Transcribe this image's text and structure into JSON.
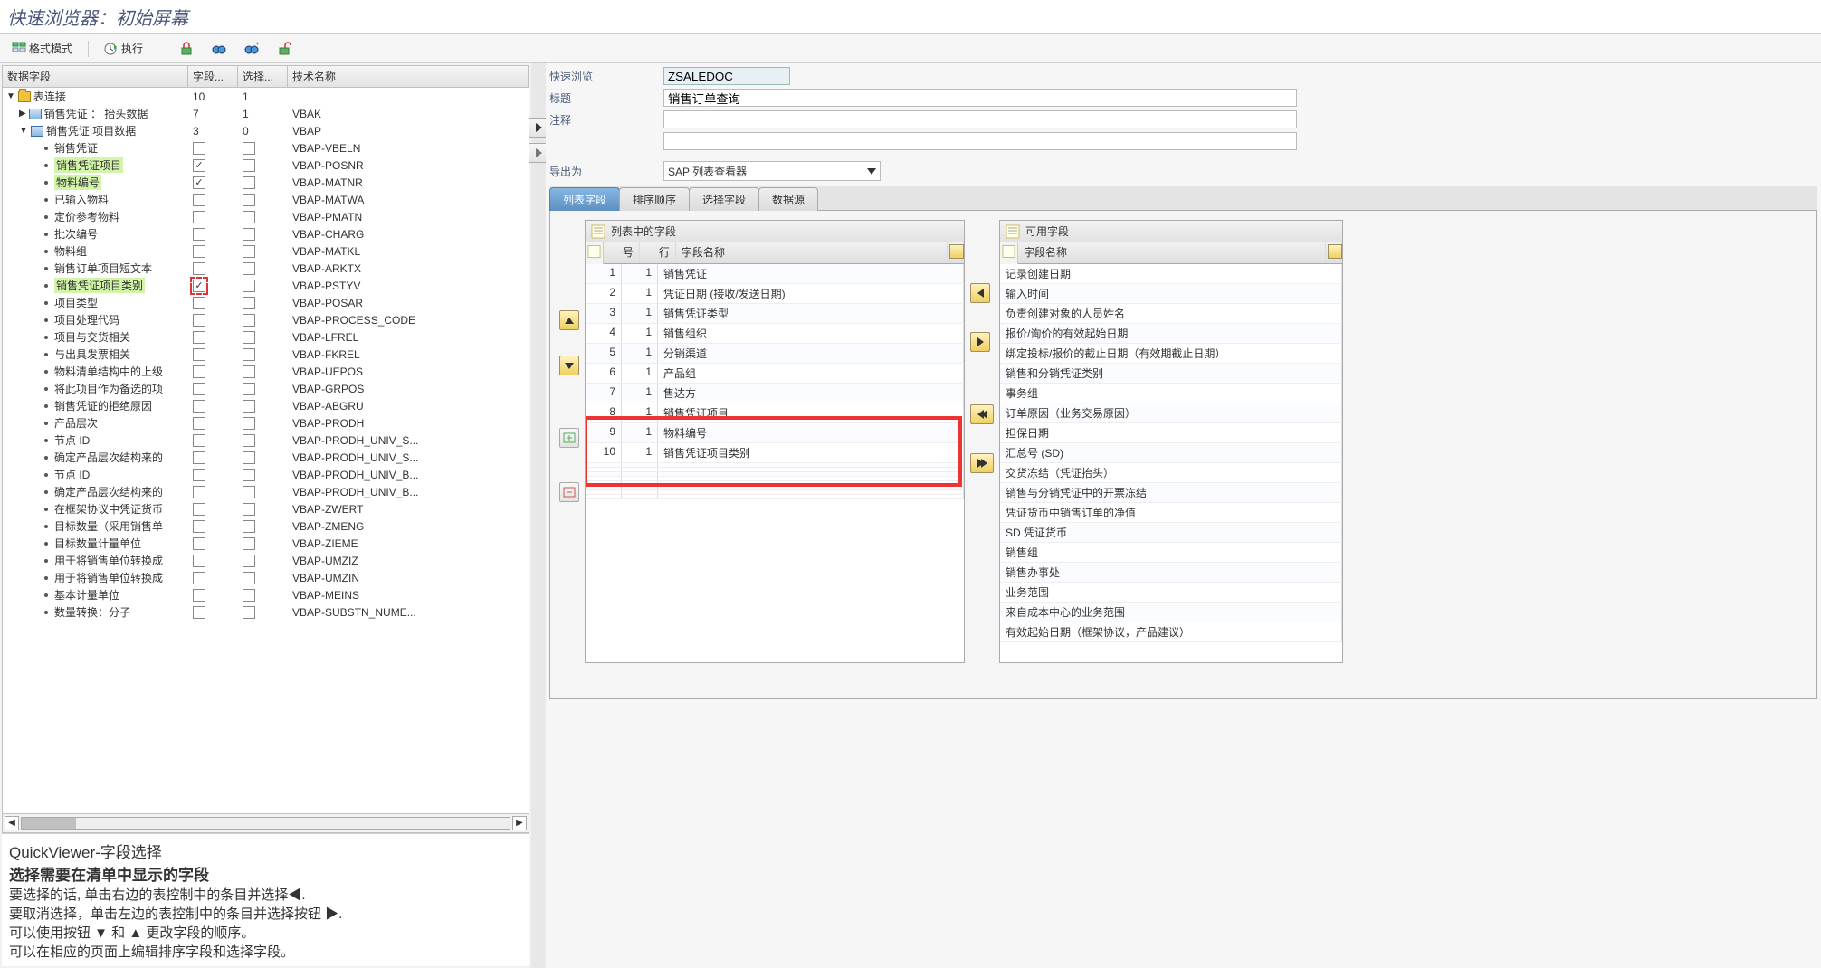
{
  "title": "快速浏览器：初始屏幕",
  "toolbar": {
    "format_mode": "格式模式",
    "execute": "执行"
  },
  "tree": {
    "header": {
      "c0": "数据字段",
      "c1": "字段...",
      "c2": "选择...",
      "c3": "技术名称"
    },
    "root": {
      "label": "表连接",
      "c1": "10",
      "c2": "1"
    },
    "n1": {
      "label": "销售凭证 ： 抬头数据",
      "c1": "7",
      "c2": "1",
      "tech": "VBAK"
    },
    "n2": {
      "label": "销售凭证:项目数据",
      "c1": "3",
      "c2": "0",
      "tech": "VBAP"
    },
    "items": [
      {
        "label": "销售凭证",
        "tech": "VBAP-VBELN",
        "chk1": false,
        "chk2": false,
        "hl": false
      },
      {
        "label": "销售凭证项目",
        "tech": "VBAP-POSNR",
        "chk1": true,
        "chk2": false,
        "hl": true
      },
      {
        "label": "物料编号",
        "tech": "VBAP-MATNR",
        "chk1": true,
        "chk2": false,
        "hl": true
      },
      {
        "label": "已输入物料",
        "tech": "VBAP-MATWA",
        "chk1": false,
        "chk2": false,
        "hl": false
      },
      {
        "label": "定价参考物料",
        "tech": "VBAP-PMATN",
        "chk1": false,
        "chk2": false,
        "hl": false
      },
      {
        "label": "批次编号",
        "tech": "VBAP-CHARG",
        "chk1": false,
        "chk2": false,
        "hl": false
      },
      {
        "label": "物料组",
        "tech": "VBAP-MATKL",
        "chk1": false,
        "chk2": false,
        "hl": false
      },
      {
        "label": "销售订单项目短文本",
        "tech": "VBAP-ARKTX",
        "chk1": false,
        "chk2": false,
        "hl": false
      },
      {
        "label": "销售凭证项目类别",
        "tech": "VBAP-PSTYV",
        "chk1": true,
        "chk2": false,
        "hl": true,
        "red": true
      },
      {
        "label": "项目类型",
        "tech": "VBAP-POSAR",
        "chk1": false,
        "chk2": false,
        "hl": false
      },
      {
        "label": "项目处理代码",
        "tech": "VBAP-PROCESS_CODE",
        "chk1": false,
        "chk2": false,
        "hl": false
      },
      {
        "label": "项目与交货相关",
        "tech": "VBAP-LFREL",
        "chk1": false,
        "chk2": false,
        "hl": false
      },
      {
        "label": "与出具发票相关",
        "tech": "VBAP-FKREL",
        "chk1": false,
        "chk2": false,
        "hl": false
      },
      {
        "label": "物料清单结构中的上级",
        "tech": "VBAP-UEPOS",
        "chk1": false,
        "chk2": false,
        "hl": false
      },
      {
        "label": "将此项目作为备选的项",
        "tech": "VBAP-GRPOS",
        "chk1": false,
        "chk2": false,
        "hl": false
      },
      {
        "label": "销售凭证的拒绝原因",
        "tech": "VBAP-ABGRU",
        "chk1": false,
        "chk2": false,
        "hl": false
      },
      {
        "label": "产品层次",
        "tech": "VBAP-PRODH",
        "chk1": false,
        "chk2": false,
        "hl": false
      },
      {
        "label": "节点 ID",
        "tech": "VBAP-PRODH_UNIV_S...",
        "chk1": false,
        "chk2": false,
        "hl": false
      },
      {
        "label": "确定产品层次结构来的",
        "tech": "VBAP-PRODH_UNIV_S...",
        "chk1": false,
        "chk2": false,
        "hl": false
      },
      {
        "label": "节点 ID",
        "tech": "VBAP-PRODH_UNIV_B...",
        "chk1": false,
        "chk2": false,
        "hl": false
      },
      {
        "label": "确定产品层次结构来的",
        "tech": "VBAP-PRODH_UNIV_B...",
        "chk1": false,
        "chk2": false,
        "hl": false
      },
      {
        "label": "在框架协议中凭证货币",
        "tech": "VBAP-ZWERT",
        "chk1": false,
        "chk2": false,
        "hl": false
      },
      {
        "label": "目标数量（采用销售单",
        "tech": "VBAP-ZMENG",
        "chk1": false,
        "chk2": false,
        "hl": false
      },
      {
        "label": "目标数量计量单位",
        "tech": "VBAP-ZIEME",
        "chk1": false,
        "chk2": false,
        "hl": false
      },
      {
        "label": "用于将销售单位转换成",
        "tech": "VBAP-UMZIZ",
        "chk1": false,
        "chk2": false,
        "hl": false
      },
      {
        "label": "用于将销售单位转换成",
        "tech": "VBAP-UMZIN",
        "chk1": false,
        "chk2": false,
        "hl": false
      },
      {
        "label": "基本计量单位",
        "tech": "VBAP-MEINS",
        "chk1": false,
        "chk2": false,
        "hl": false
      },
      {
        "label": "数量转换：分子",
        "tech": "VBAP-SUBSTN_NUME...",
        "chk1": false,
        "chk2": false,
        "hl": false
      }
    ]
  },
  "help": {
    "h1": "QuickViewer-字段选择",
    "h2": "选择需要在清单中显示的字段",
    "l1": "要选择的话, 单击右边的表控制中的条目并选择◀.",
    "l2": "要取消选择，单击左边的表控制中的条目并选择按钮 ▶.",
    "l3": "可以使用按钮 ▼ 和 ▲ 更改字段的顺序。",
    "l4": "可以在相应的页面上编辑排序字段和选择字段。"
  },
  "form": {
    "l_quick": "快速浏览",
    "v_quick": "ZSALEDOC",
    "l_title": "标题",
    "v_title": "销售订单查询",
    "l_comment": "注释",
    "v_comment": "",
    "l_export": "导出为",
    "v_export": "SAP 列表查看器"
  },
  "tabs": {
    "t1": "列表字段",
    "t2": "排序顺序",
    "t3": "选择字段",
    "t4": "数据源"
  },
  "selected": {
    "title": "列表中的字段",
    "h_no": "号",
    "h_row": "行",
    "h_name": "字段名称",
    "rows": [
      {
        "no": "1",
        "row": "1",
        "name": "销售凭证"
      },
      {
        "no": "2",
        "row": "1",
        "name": "凭证日期 (接收/发送日期)"
      },
      {
        "no": "3",
        "row": "1",
        "name": "销售凭证类型"
      },
      {
        "no": "4",
        "row": "1",
        "name": "销售组织"
      },
      {
        "no": "5",
        "row": "1",
        "name": "分销渠道"
      },
      {
        "no": "6",
        "row": "1",
        "name": "产品组"
      },
      {
        "no": "7",
        "row": "1",
        "name": "售达方"
      },
      {
        "no": "8",
        "row": "1",
        "name": "销售凭证项目"
      },
      {
        "no": "9",
        "row": "1",
        "name": "物料编号"
      },
      {
        "no": "10",
        "row": "1",
        "name": "销售凭证项目类别"
      }
    ]
  },
  "available": {
    "title": "可用字段",
    "h_name": "字段名称",
    "rows": [
      "记录创建日期",
      "输入时间",
      "负责创建对象的人员姓名",
      "报价/询价的有效起始日期",
      "绑定投标/报价的截止日期（有效期截止日期）",
      "销售和分销凭证类别",
      "事务组",
      "订单原因（业务交易原因）",
      "担保日期",
      "汇总号 (SD)",
      "交货冻结（凭证抬头）",
      "销售与分销凭证中的开票冻结",
      "凭证货币中销售订单的净值",
      "SD 凭证货币",
      "销售组",
      "销售办事处",
      "业务范围",
      "来自成本中心的业务范围",
      "有效起始日期（框架协议，产品建议）"
    ]
  }
}
